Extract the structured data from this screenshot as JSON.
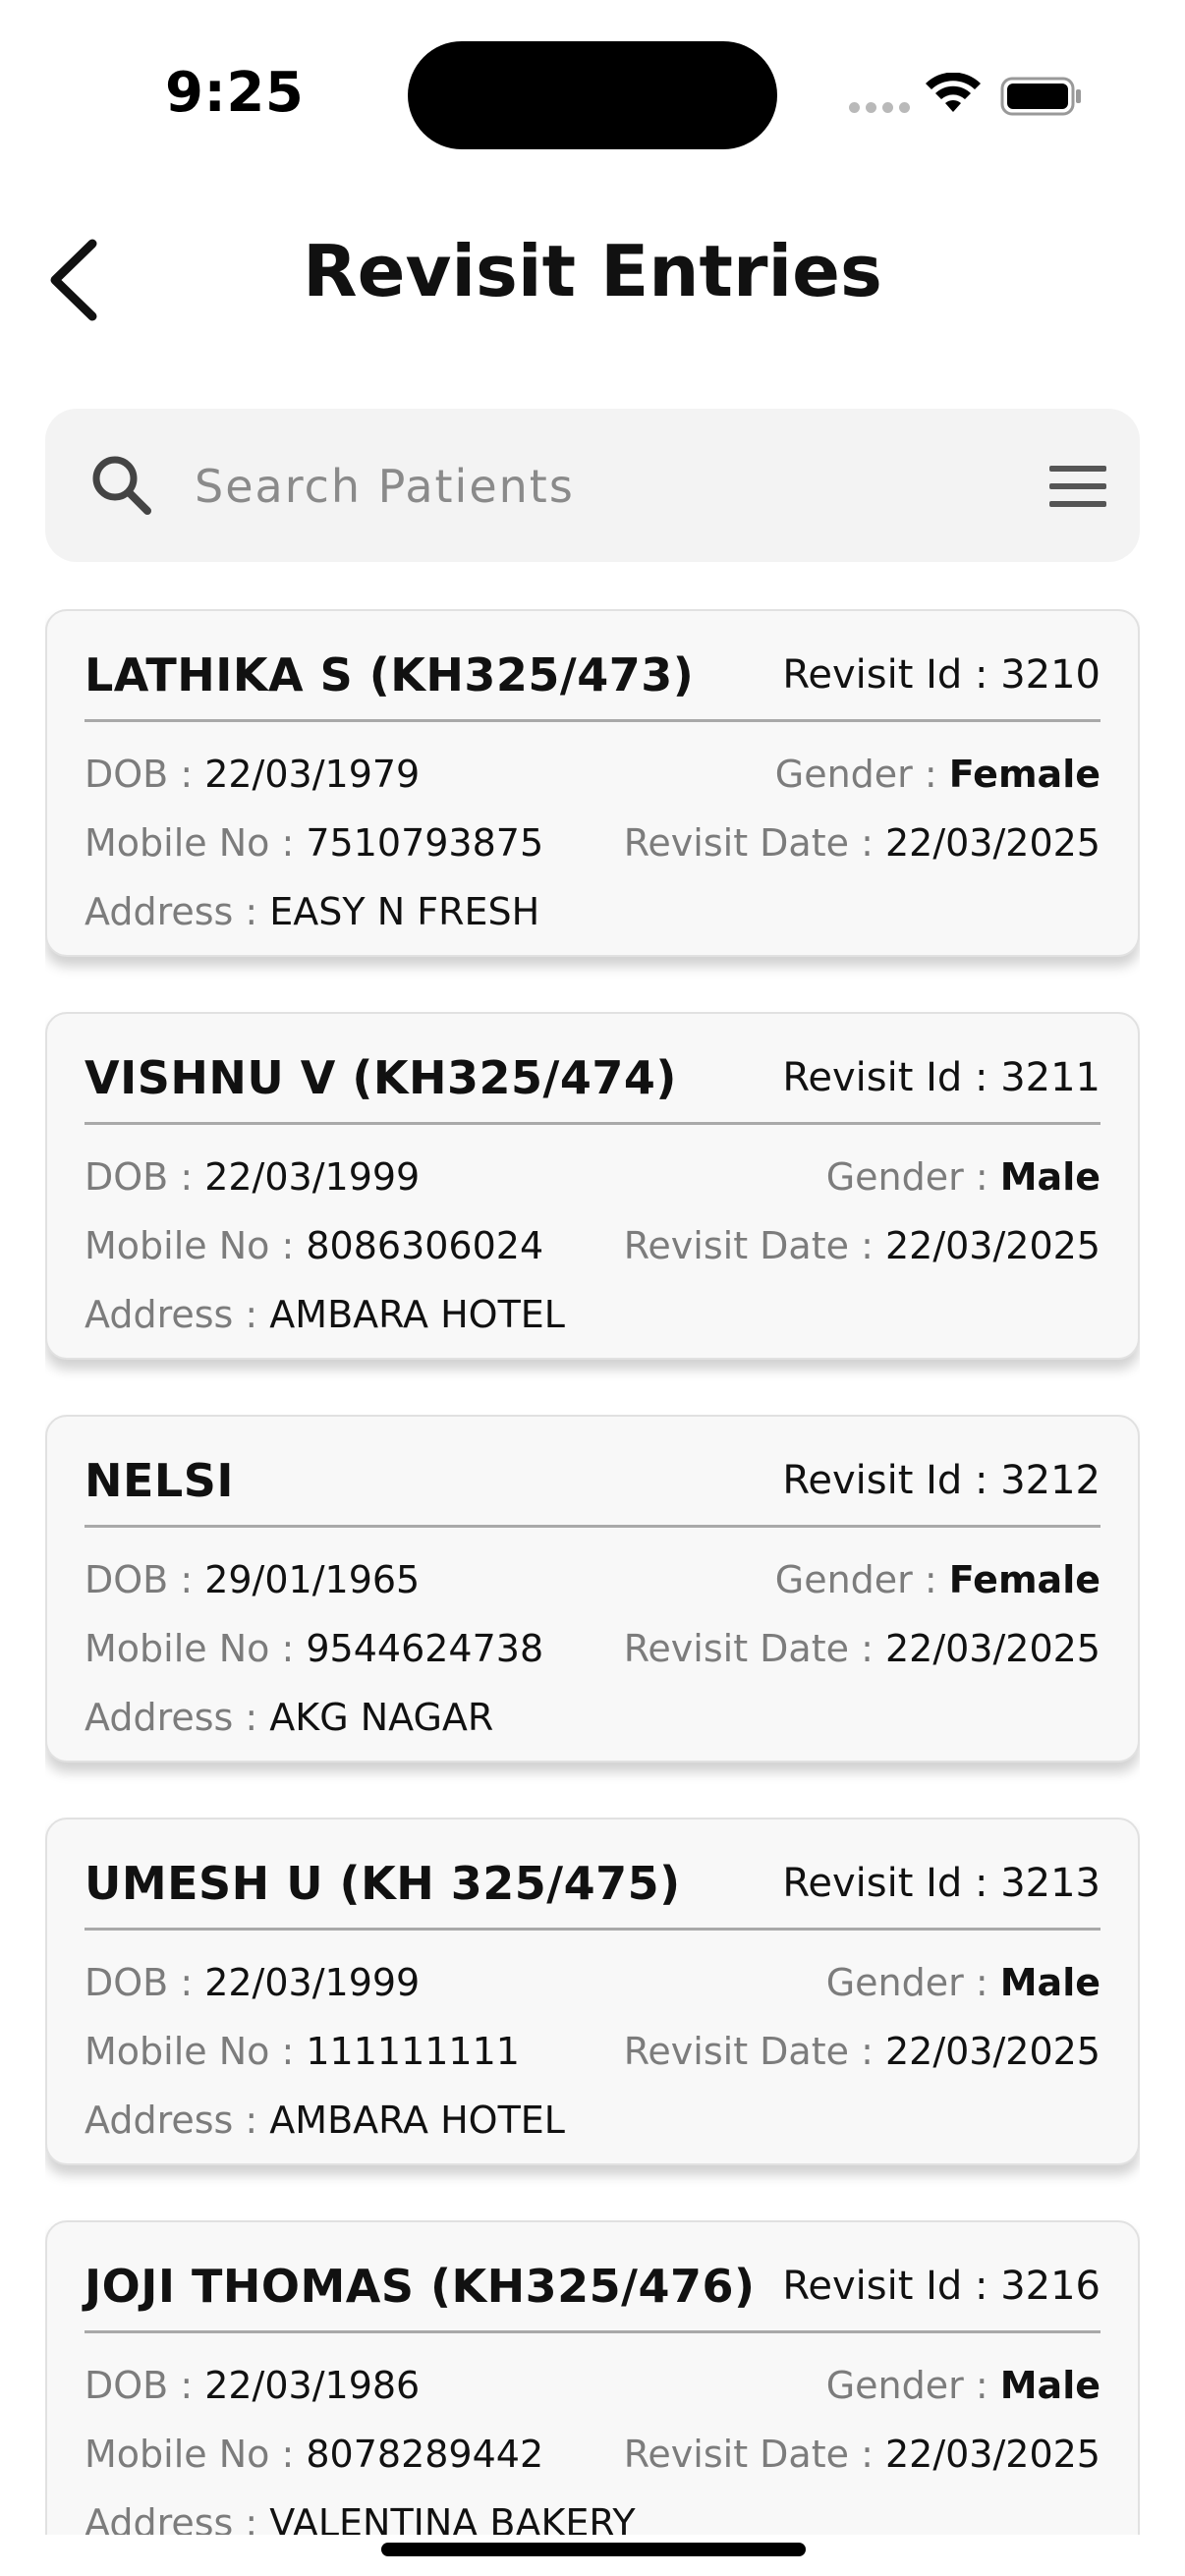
{
  "status_bar": {
    "time": "9:25"
  },
  "header": {
    "title": "Revisit Entries"
  },
  "search": {
    "placeholder": "Search Patients",
    "value": ""
  },
  "labels": {
    "revisit_id": "Revisit Id : ",
    "dob": "DOB : ",
    "gender": "Gender : ",
    "mobile": "Mobile No : ",
    "revisit_date": "Revisit Date : ",
    "address": "Address : "
  },
  "entries": [
    {
      "name": "LATHIKA S (KH325/473)",
      "revisit_id": "3210",
      "dob": "22/03/1979",
      "gender": "Female",
      "mobile": "7510793875",
      "revisit_date": "22/03/2025",
      "address": "EASY N FRESH"
    },
    {
      "name": "VISHNU V (KH325/474)",
      "revisit_id": "3211",
      "dob": "22/03/1999",
      "gender": "Male",
      "mobile": "8086306024",
      "revisit_date": "22/03/2025",
      "address": "AMBARA HOTEL"
    },
    {
      "name": "NELSI",
      "revisit_id": "3212",
      "dob": "29/01/1965",
      "gender": "Female",
      "mobile": "9544624738",
      "revisit_date": "22/03/2025",
      "address": "AKG NAGAR"
    },
    {
      "name": "UMESH U (KH 325/475)",
      "revisit_id": "3213",
      "dob": "22/03/1999",
      "gender": "Male",
      "mobile": "111111111",
      "revisit_date": "22/03/2025",
      "address": "AMBARA HOTEL"
    },
    {
      "name": "JOJI THOMAS (KH325/476)",
      "revisit_id": "3216",
      "dob": "22/03/1986",
      "gender": "Male",
      "mobile": "8078289442",
      "revisit_date": "22/03/2025",
      "address": "VALENTINA BAKERY"
    }
  ],
  "colors": {
    "card_bg": "#f8f8f8",
    "search_bg": "#f3f3f3",
    "label_gray": "#7c7c7c",
    "text_dark": "#111111"
  },
  "icons": [
    "back-chevron-icon",
    "search-icon",
    "menu-icon",
    "wifi-icon",
    "battery-icon"
  ]
}
